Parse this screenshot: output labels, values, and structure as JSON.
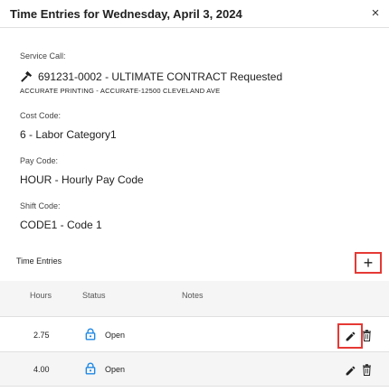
{
  "dialog": {
    "title": "Time Entries for Wednesday, April 3, 2024",
    "close_label": "×"
  },
  "service_call": {
    "label": "Service Call:",
    "icon": "hammer-icon",
    "value": "691231-0002 - ULTIMATE CONTRACT Requested",
    "subtitle": "ACCURATE PRINTING - ACCURATE-12500 CLEVELAND AVE"
  },
  "cost_code": {
    "label": "Cost Code:",
    "value": "6 - Labor Category1"
  },
  "pay_code": {
    "label": "Pay Code:",
    "value": "HOUR - Hourly Pay Code"
  },
  "shift_code": {
    "label": "Shift Code:",
    "value": "CODE1 - Code 1"
  },
  "time_entries": {
    "title": "Time Entries",
    "add_label": "+",
    "columns": {
      "hours": "Hours",
      "status": "Status",
      "notes": "Notes"
    },
    "rows": [
      {
        "hours": "2.75",
        "status": "Open",
        "notes": ""
      },
      {
        "hours": "4.00",
        "status": "Open",
        "notes": ""
      }
    ]
  },
  "colors": {
    "highlight": "#e53935",
    "lock_icon": "#1e88e5",
    "row_alt": "#f5f5f5"
  }
}
